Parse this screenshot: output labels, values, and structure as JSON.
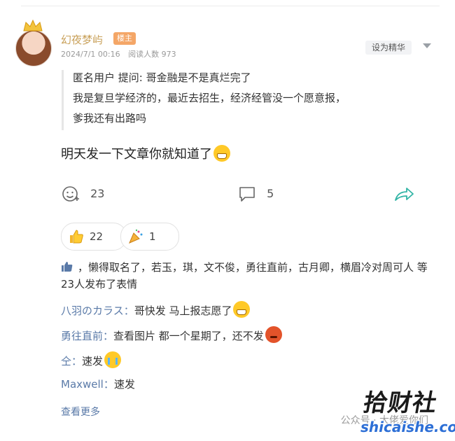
{
  "post": {
    "author": "幻夜梦屿",
    "role_badge": "楼主",
    "date": "2024/7/1 00:16",
    "read_label": "阅读人数 973",
    "featured_button": "设为精华",
    "quote": {
      "line1": "匿名用户  提问: 哥金融是不是真烂完了",
      "line2": "我是复旦学经济的，最近去招生，经济经管没一个愿意报，",
      "line3": "爹我还有出路吗"
    },
    "content": "明天发一下文章你就知道了",
    "comment_react_count": "23",
    "comment_count": "5"
  },
  "reactions": {
    "thumbs_count": "22",
    "party_count": "1"
  },
  "likes": {
    "text": "，懒得取名了，若玉，琪，文不俊，勇往直前，古月卿，横眉冷对周可人  等23人发布了表情"
  },
  "replies": [
    {
      "author": "八羽のカラス：",
      "text": "哥快发 马上报志愿了"
    },
    {
      "author": "勇往直前：",
      "text": "查看图片  都一个星期了，还不发"
    },
    {
      "author": "仝：",
      "text": "速发"
    },
    {
      "author": "Maxwell：",
      "text": "速发"
    }
  ],
  "see_more": "查看更多",
  "watermarks": {
    "wechat": "公众号 · 大佬爱你们",
    "brand": "拾财社",
    "site": "shicaishe.com"
  },
  "icons": {
    "comment_emoji": "emoji-add-icon",
    "comment": "comment-bubble-icon",
    "share": "share-arrow-icon",
    "thumbs": "thumbs-up-icon",
    "party": "party-popper-icon"
  },
  "colors": {
    "author": "#c9a15a",
    "badge": "#f4a667",
    "reply_author": "#5a7aa8",
    "share": "#33b5a6"
  }
}
